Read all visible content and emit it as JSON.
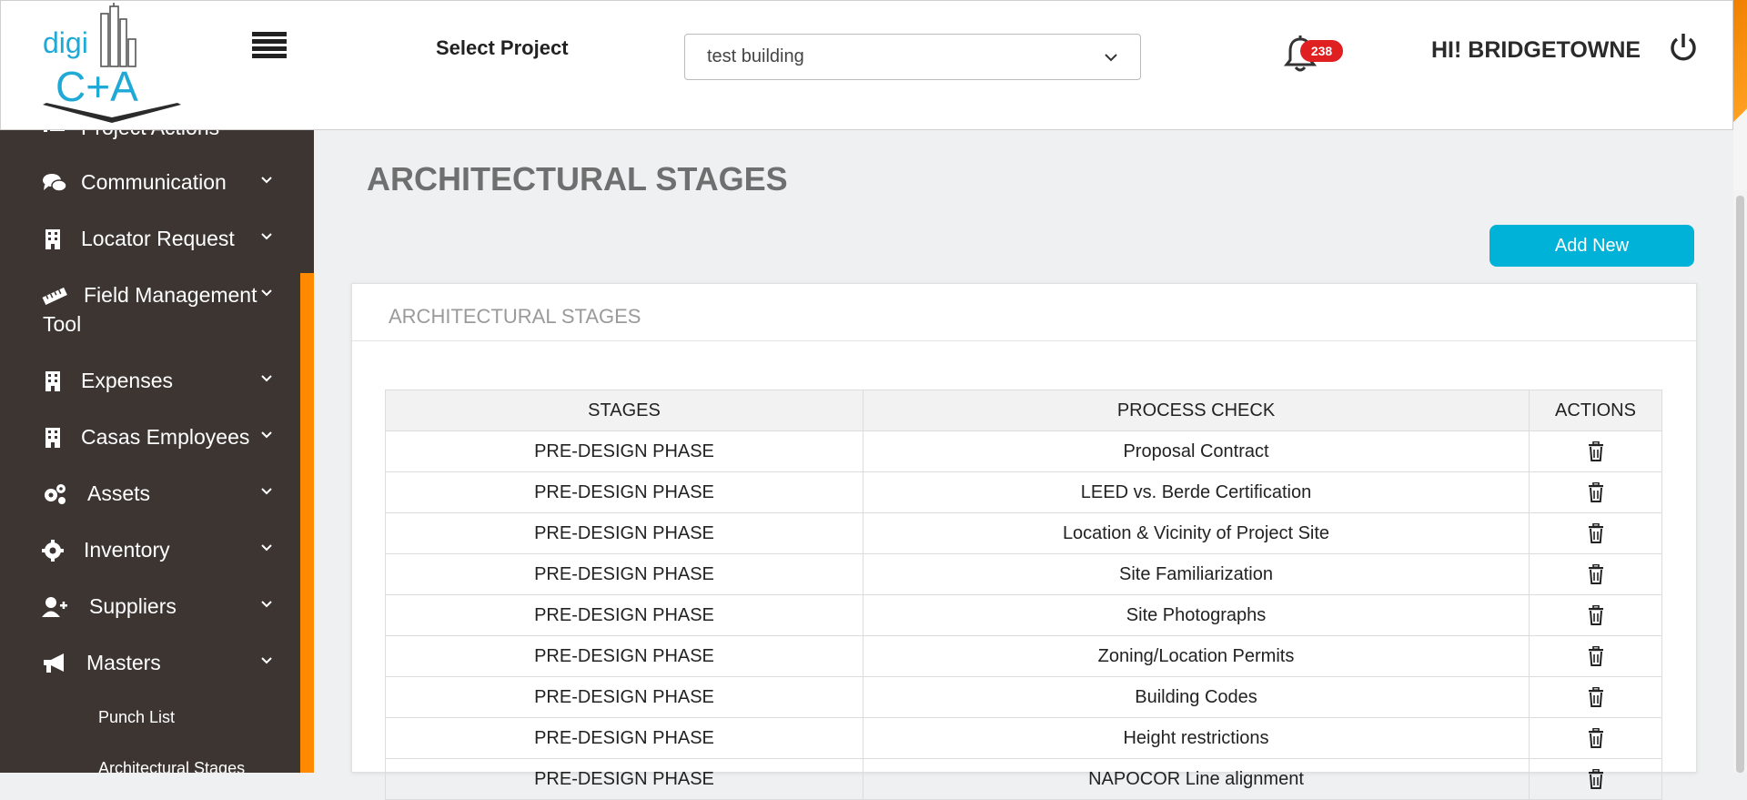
{
  "brand": {
    "logo_text_top": "digi",
    "logo_text_bottom": "C+A"
  },
  "header": {
    "select_label": "Select Project",
    "project_value": "test building",
    "notification_count": "238",
    "greeting": "HI! BRIDGETOWNE"
  },
  "sidebar": {
    "partial_item": "Project Actions",
    "items": [
      {
        "label": "Communication",
        "icon": "comments-icon"
      },
      {
        "label": "Locator Request",
        "icon": "building-icon"
      },
      {
        "label": "Field Management",
        "label2": "Tool",
        "icon": "ruler-icon"
      },
      {
        "label": "Expenses",
        "icon": "building-icon"
      },
      {
        "label": "Casas Employees",
        "icon": "building-icon"
      },
      {
        "label": "Assets",
        "icon": "cogs-icon"
      },
      {
        "label": "Inventory",
        "icon": "gear-icon"
      },
      {
        "label": "Suppliers",
        "icon": "user-plus-icon"
      },
      {
        "label": "Masters",
        "icon": "megaphone-icon"
      }
    ],
    "sub_items": [
      {
        "label": "Punch List"
      },
      {
        "label": "Architectural Stages"
      }
    ]
  },
  "main": {
    "page_title": "ARCHITECTURAL STAGES",
    "add_button": "Add New",
    "card_title": "ARCHITECTURAL STAGES",
    "table": {
      "columns": [
        "STAGES",
        "PROCESS CHECK",
        "ACTIONS"
      ],
      "rows": [
        [
          "PRE-DESIGN PHASE",
          "Proposal Contract"
        ],
        [
          "PRE-DESIGN PHASE",
          "LEED vs. Berde Certification"
        ],
        [
          "PRE-DESIGN PHASE",
          "Location & Vicinity of Project Site"
        ],
        [
          "PRE-DESIGN PHASE",
          "Site Familiarization"
        ],
        [
          "PRE-DESIGN PHASE",
          "Site Photographs"
        ],
        [
          "PRE-DESIGN PHASE",
          "Zoning/Location Permits"
        ],
        [
          "PRE-DESIGN PHASE",
          "Building Codes"
        ],
        [
          "PRE-DESIGN PHASE",
          "Height restrictions"
        ],
        [
          "PRE-DESIGN PHASE",
          "NAPOCOR Line alignment"
        ]
      ]
    }
  },
  "colors": {
    "accent_orange": "#ff8a00",
    "button_cyan": "#00b2d8",
    "sidebar_bg": "#3d3532",
    "badge_red": "#e02020"
  }
}
